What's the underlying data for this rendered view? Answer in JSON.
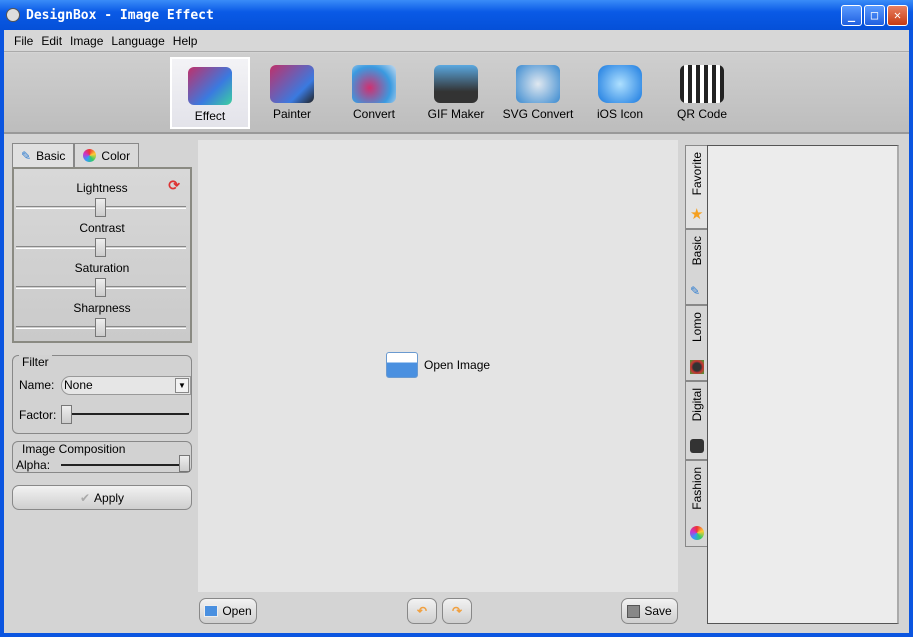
{
  "window": {
    "title": "DesignBox - Image Effect",
    "controls": [
      "minimize",
      "maximize",
      "close"
    ]
  },
  "menu": [
    "File",
    "Edit",
    "Image",
    "Language",
    "Help"
  ],
  "toolbar": [
    {
      "label": "Effect",
      "icon": "effect-icon",
      "selected": true
    },
    {
      "label": "Painter",
      "icon": "painter-icon"
    },
    {
      "label": "Convert",
      "icon": "convert-icon"
    },
    {
      "label": "GIF Maker",
      "icon": "gif-maker-icon"
    },
    {
      "label": "SVG Convert",
      "icon": "svg-convert-icon"
    },
    {
      "label": "iOS Icon",
      "icon": "ios-icon-icon"
    },
    {
      "label": "QR Code",
      "icon": "qr-code-icon"
    }
  ],
  "left": {
    "tabs": [
      {
        "label": "Basic",
        "active": true
      },
      {
        "label": "Color"
      }
    ],
    "sliders": [
      {
        "label": "Lightness",
        "value": 50
      },
      {
        "label": "Contrast",
        "value": 50
      },
      {
        "label": "Saturation",
        "value": 50
      },
      {
        "label": "Sharpness",
        "value": 50
      }
    ],
    "filter": {
      "title": "Filter",
      "name_label": "Name:",
      "name_value": "None",
      "factor_label": "Factor:",
      "factor_value": 0
    },
    "composition": {
      "title": "Image Composition",
      "alpha_label": "Alpha:",
      "alpha_value": 100
    },
    "apply": "Apply"
  },
  "canvas": {
    "open_image": "Open Image"
  },
  "bottom": {
    "open": "Open",
    "save": "Save"
  },
  "right_tabs": [
    {
      "label": "Favorite",
      "active": true
    },
    {
      "label": "Basic"
    },
    {
      "label": "Lomo"
    },
    {
      "label": "Digital"
    },
    {
      "label": "Fashion"
    }
  ],
  "colors": {
    "title_bar": "#0550d8",
    "canvas": "#e4e4e4"
  }
}
